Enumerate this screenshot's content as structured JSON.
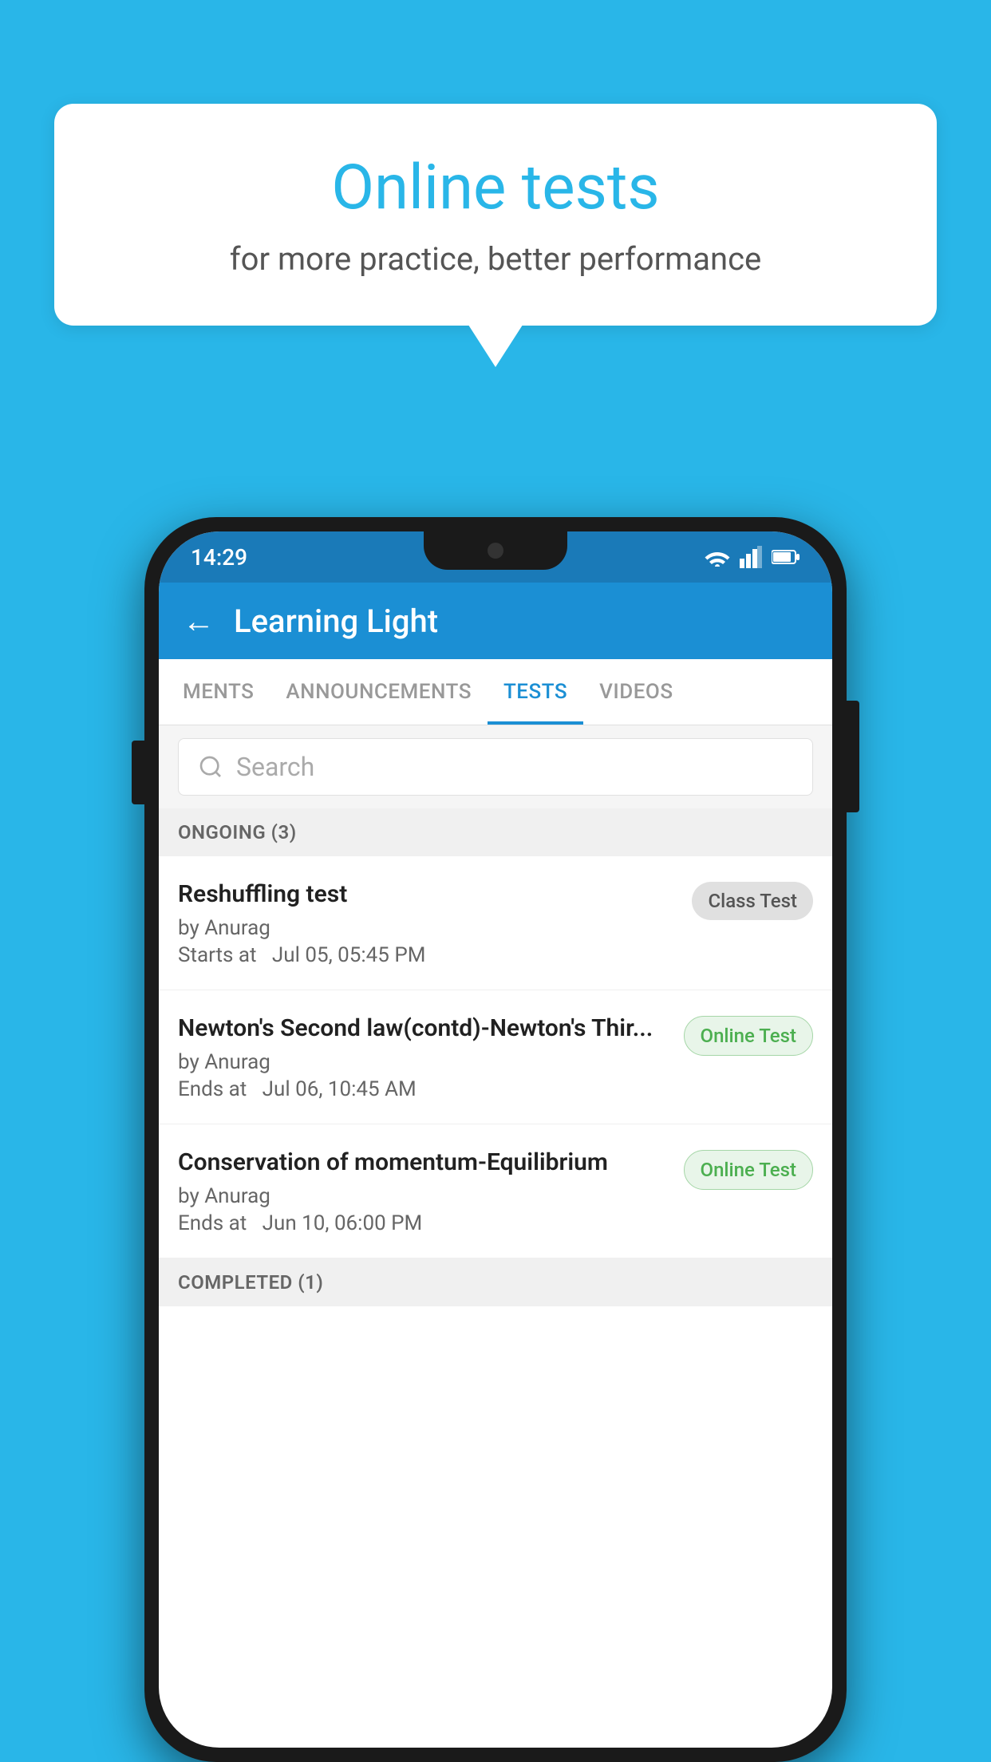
{
  "background": {
    "color": "#29b6e8"
  },
  "speech_bubble": {
    "title": "Online tests",
    "subtitle": "for more practice, better performance"
  },
  "phone": {
    "status_bar": {
      "time": "14:29",
      "icons": [
        "wifi",
        "signal",
        "battery"
      ]
    },
    "app_bar": {
      "title": "Learning Light",
      "back_label": "←"
    },
    "tabs": [
      {
        "label": "MENTS",
        "active": false
      },
      {
        "label": "ANNOUNCEMENTS",
        "active": false
      },
      {
        "label": "TESTS",
        "active": true
      },
      {
        "label": "VIDEOS",
        "active": false
      }
    ],
    "search": {
      "placeholder": "Search"
    },
    "sections": [
      {
        "title": "ONGOING (3)",
        "items": [
          {
            "name": "Reshuffling test",
            "author": "by Anurag",
            "date_label": "Starts at",
            "date": "Jul 05, 05:45 PM",
            "badge": "Class Test",
            "badge_type": "class"
          },
          {
            "name": "Newton's Second law(contd)-Newton's Thir...",
            "author": "by Anurag",
            "date_label": "Ends at",
            "date": "Jul 06, 10:45 AM",
            "badge": "Online Test",
            "badge_type": "online"
          },
          {
            "name": "Conservation of momentum-Equilibrium",
            "author": "by Anurag",
            "date_label": "Ends at",
            "date": "Jun 10, 06:00 PM",
            "badge": "Online Test",
            "badge_type": "online"
          }
        ]
      },
      {
        "title": "COMPLETED (1)",
        "items": []
      }
    ]
  }
}
